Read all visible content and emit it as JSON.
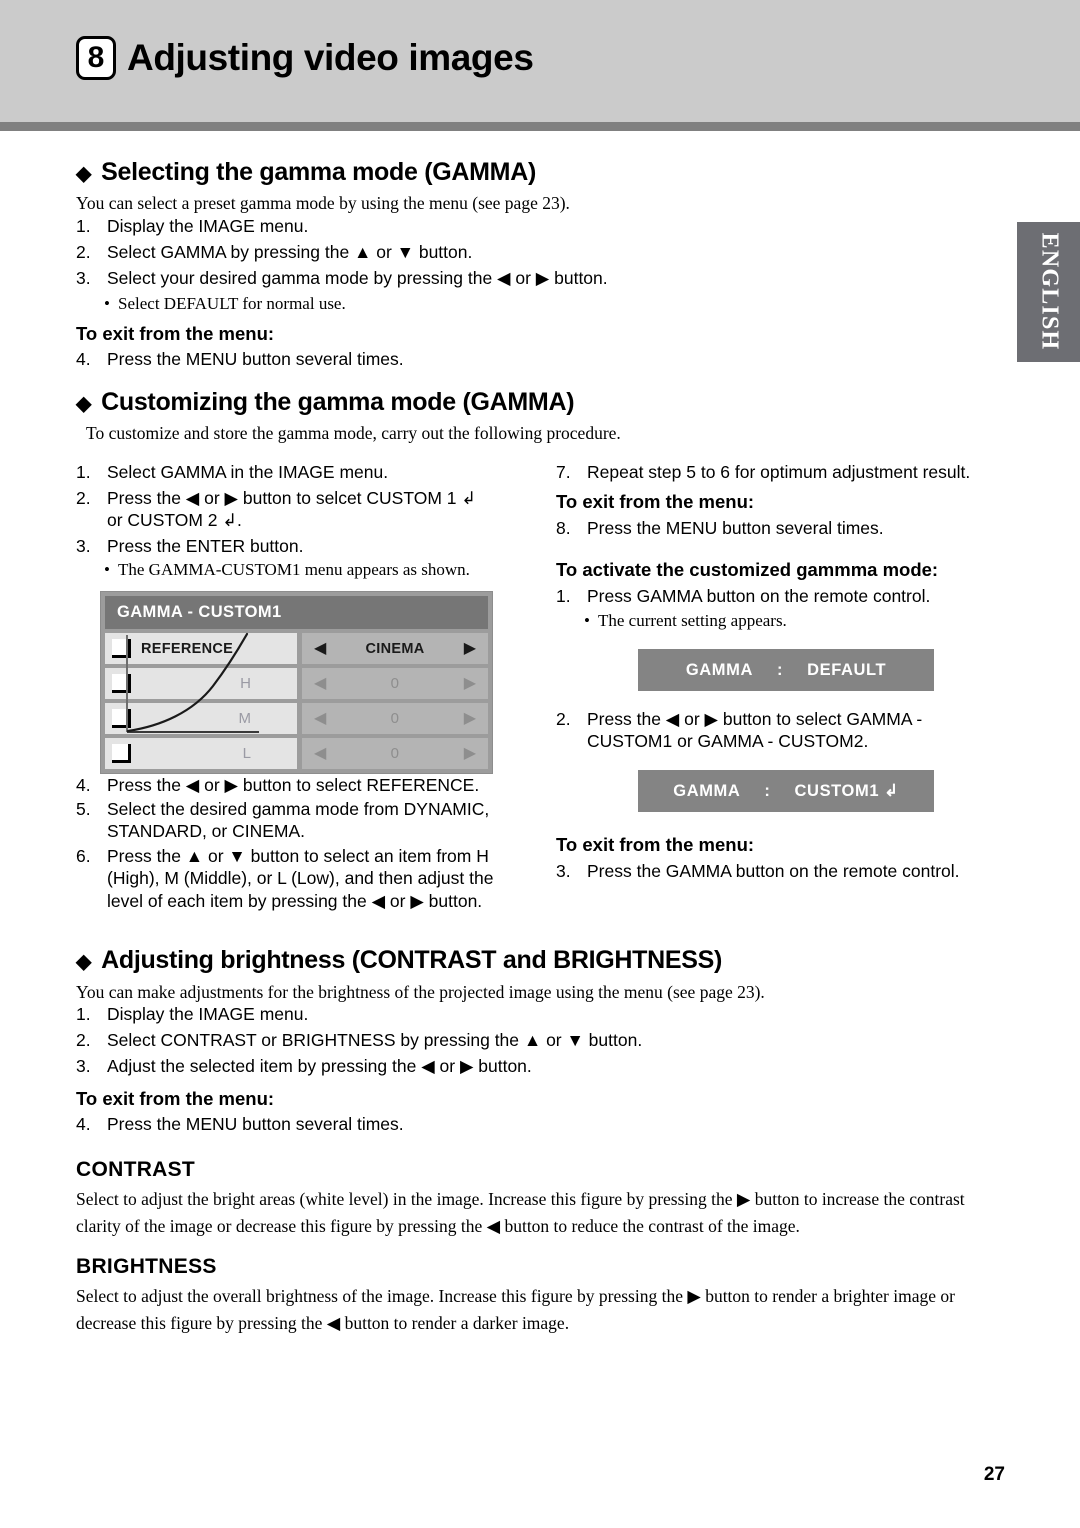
{
  "header": {
    "chapter_number": "8",
    "chapter_title": "Adjusting video images"
  },
  "language_tab": {
    "label": "ENGLISH"
  },
  "page_number": "27",
  "sections": {
    "gamma_select": {
      "diamond": "◆",
      "heading": "Selecting the gamma mode (GAMMA)",
      "intro": "You can select a preset gamma mode by using the menu (see page 23).",
      "steps": [
        {
          "num": "1.",
          "text": "Display the IMAGE menu."
        },
        {
          "num": "2.",
          "text": "Select GAMMA by pressing the ▲ or ▼ button."
        },
        {
          "num": "3.",
          "text": "Select your desired gamma mode by pressing the ◀ or ▶ button."
        }
      ],
      "bullet": "Select DEFAULT for normal use.",
      "exit_head": "To exit from the menu:",
      "exit_step": {
        "num": "4.",
        "text": "Press the MENU button several times."
      }
    },
    "gamma_custom": {
      "diamond": "◆",
      "heading": "Customizing the gamma mode (GAMMA)",
      "intro": "To customize and store the gamma mode, carry out the following procedure.",
      "left_steps": [
        {
          "num": "1.",
          "text": "Select GAMMA in the IMAGE menu."
        },
        {
          "num": "2.",
          "text": "Press the ◀ or ▶ button to selcet CUSTOM 1 ↲ or CUSTOM 2 ↲."
        },
        {
          "num": "3.",
          "text": "Press the ENTER button."
        }
      ],
      "left_bullet": "The GAMMA-CUSTOM1 menu appears as shown.",
      "left_steps2": [
        {
          "num": "4.",
          "text": "Press the ◀ or ▶ button to select REFERENCE."
        },
        {
          "num": "5.",
          "text": "Select the desired gamma mode from DYNAMIC, STANDARD, or CINEMA."
        },
        {
          "num": "6.",
          "text": "Press the ▲ or ▼ button to select an item from H (High), M (Middle), or L (Low), and then adjust the level of each item by pressing the ◀ or ▶ button."
        }
      ],
      "right_step7": {
        "num": "7.",
        "text": "Repeat step 5 to 6 for optimum adjustment result."
      },
      "right_exit_head": "To exit from the menu:",
      "right_step8": {
        "num": "8.",
        "text": "Press the MENU button several times."
      },
      "activate_head": "To activate the customized gammma mode:",
      "activate_step1": {
        "num": "1.",
        "text": "Press GAMMA button on the remote control."
      },
      "activate_bullet": "The current setting appears.",
      "activate_step2": {
        "num": "2.",
        "text": "Press the ◀ or ▶ button to select GAMMA - CUSTOM1 or GAMMA - CUSTOM2."
      },
      "activate_exit_head": "To exit from the menu:",
      "activate_step3": {
        "num": "3.",
        "text": "Press the GAMMA button on the remote control."
      }
    },
    "brightness": {
      "diamond": "◆",
      "heading": "Adjusting brightness (CONTRAST and BRIGHTNESS)",
      "intro": "You can make adjustments for the brightness of the projected image using the menu (see page 23).",
      "steps": [
        {
          "num": "1.",
          "text": "Display the IMAGE menu."
        },
        {
          "num": "2.",
          "text": "Select CONTRAST or BRIGHTNESS by pressing the ▲ or ▼ button."
        },
        {
          "num": "3.",
          "text": "Adjust the selected item by pressing the ◀ or ▶ button."
        }
      ],
      "exit_head": "To exit from the menu:",
      "exit_step": {
        "num": "4.",
        "text": "Press the MENU button several times."
      },
      "contrast_head": "CONTRAST",
      "contrast_body": "Select to adjust the bright areas (white level) in the image. Increase this figure by pressing the ▶ button to increase the contrast clarity of the image or decrease this figure by pressing the ◀ button to reduce the contrast of the image.",
      "brightness_head": "BRIGHTNESS",
      "brightness_body": "Select to adjust the overall brightness of the image. Increase this figure by pressing the ▶ button to render a brighter image or decrease this figure by pressing the ◀ button to render a darker image."
    }
  },
  "osd_menu": {
    "title": "GAMMA - CUSTOM1",
    "rows": [
      {
        "label": "REFERENCE",
        "value": "CINEMA",
        "active": true
      },
      {
        "label": "H",
        "value": "0",
        "active": false
      },
      {
        "label": "M",
        "value": "0",
        "active": false
      },
      {
        "label": "L",
        "value": "0",
        "active": false
      }
    ],
    "left_arrow": "◀",
    "right_arrow": "▶"
  },
  "osd_bars": {
    "default_bar": {
      "name": "GAMMA",
      "sep": ":",
      "value": "DEFAULT"
    },
    "custom_bar": {
      "name": "GAMMA",
      "sep": ":",
      "value": "CUSTOM1 ↲"
    }
  }
}
